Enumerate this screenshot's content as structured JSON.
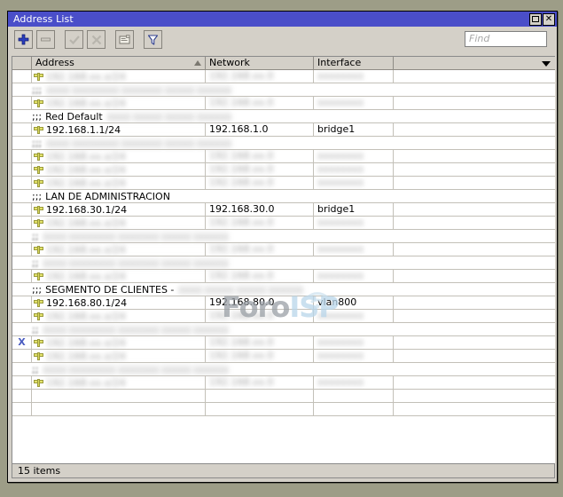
{
  "window": {
    "title": "Address List",
    "maximize_label": "□",
    "close_label": "✕"
  },
  "toolbar": {
    "add_label": "+",
    "remove_label": "−",
    "enable_label": "✓",
    "disable_label": "✕",
    "comment_label": "comment",
    "filter_label": "filter",
    "icons": [
      "add-icon",
      "remove-icon",
      "enable-check-icon",
      "disable-cross-icon",
      "comment-icon",
      "filter-funnel-icon"
    ]
  },
  "search": {
    "value": "",
    "placeholder": "Find"
  },
  "table": {
    "columns": [
      {
        "key": "flag",
        "label": ""
      },
      {
        "key": "address",
        "label": "Address",
        "sorted": "asc"
      },
      {
        "key": "network",
        "label": "Network"
      },
      {
        "key": "interface",
        "label": "Interface"
      },
      {
        "key": "extra",
        "label": ""
      }
    ],
    "rows": [
      {
        "type": "entry",
        "flag": "",
        "address": "",
        "network": "",
        "interface": "",
        "redacted": true
      },
      {
        "type": "comment",
        "comment_prefix": ";;;",
        "comment": "",
        "redacted": true
      },
      {
        "type": "entry",
        "flag": "",
        "address": "",
        "network": "",
        "interface": "",
        "redacted": true
      },
      {
        "type": "comment",
        "comment_prefix": ";;;",
        "comment": "Red Default",
        "comment_extra_redacted": true
      },
      {
        "type": "entry",
        "flag": "",
        "address": "192.168.1.1/24",
        "network": "192.168.1.0",
        "interface": "bridge1"
      },
      {
        "type": "comment",
        "comment_prefix": ";;;",
        "comment": "",
        "redacted": true
      },
      {
        "type": "entry",
        "flag": "",
        "address": "",
        "network": "",
        "interface": "",
        "redacted": true
      },
      {
        "type": "entry",
        "flag": "",
        "address": "",
        "network": "",
        "interface": "",
        "redacted": true
      },
      {
        "type": "entry",
        "flag": "",
        "address": "",
        "network": "",
        "interface": "",
        "redacted": true
      },
      {
        "type": "comment",
        "comment_prefix": ";;;",
        "comment": "LAN DE ADMINISTRACION"
      },
      {
        "type": "entry",
        "flag": "",
        "address": "192.168.30.1/24",
        "network": "192.168.30.0",
        "interface": "bridge1"
      },
      {
        "type": "entry",
        "flag": "",
        "address": "",
        "network": "",
        "interface": "",
        "redacted": true
      },
      {
        "type": "comment",
        "comment_prefix": ";;",
        "comment": "",
        "redacted": true
      },
      {
        "type": "entry",
        "flag": "",
        "address": "",
        "network": "",
        "interface": "",
        "redacted": true
      },
      {
        "type": "comment",
        "comment_prefix": ";;",
        "comment": "",
        "redacted": true
      },
      {
        "type": "entry",
        "flag": "",
        "address": "",
        "network": "",
        "interface": "",
        "redacted": true
      },
      {
        "type": "comment",
        "comment_prefix": ";;;",
        "comment": "SEGMENTO DE CLIENTES -",
        "comment_extra_redacted": true
      },
      {
        "type": "entry",
        "flag": "",
        "address": "192.168.80.1/24",
        "network": "192.168.80.0",
        "interface": "vlan800"
      },
      {
        "type": "entry",
        "flag": "",
        "address": "",
        "network": "",
        "interface": "",
        "redacted": true
      },
      {
        "type": "comment",
        "comment_prefix": ";;",
        "comment": "",
        "redacted": true
      },
      {
        "type": "entry",
        "flag": "X",
        "address": "",
        "network": "",
        "interface": "",
        "redacted": true
      },
      {
        "type": "entry",
        "flag": "",
        "address": "",
        "network": "",
        "interface": "",
        "redacted": true
      },
      {
        "type": "comment",
        "comment_prefix": ";;",
        "comment": "",
        "redacted": true
      },
      {
        "type": "entry",
        "flag": "",
        "address": "",
        "network": "",
        "interface": "",
        "redacted": true
      }
    ]
  },
  "watermark": {
    "part1": "Foro",
    "part2": "ISP"
  },
  "statusbar": {
    "items_text": "15 items"
  },
  "colors": {
    "titlebar": "#4a4ec9",
    "window_face": "#d4d0c8",
    "desktop": "#9d9d87",
    "grid_line": "#c3c0b8",
    "flag_x": "#4a5cc0",
    "pin_yellow": "#e3e36a",
    "watermark_foro": "#9aa0a6",
    "watermark_isp": "#b9d6ea"
  }
}
